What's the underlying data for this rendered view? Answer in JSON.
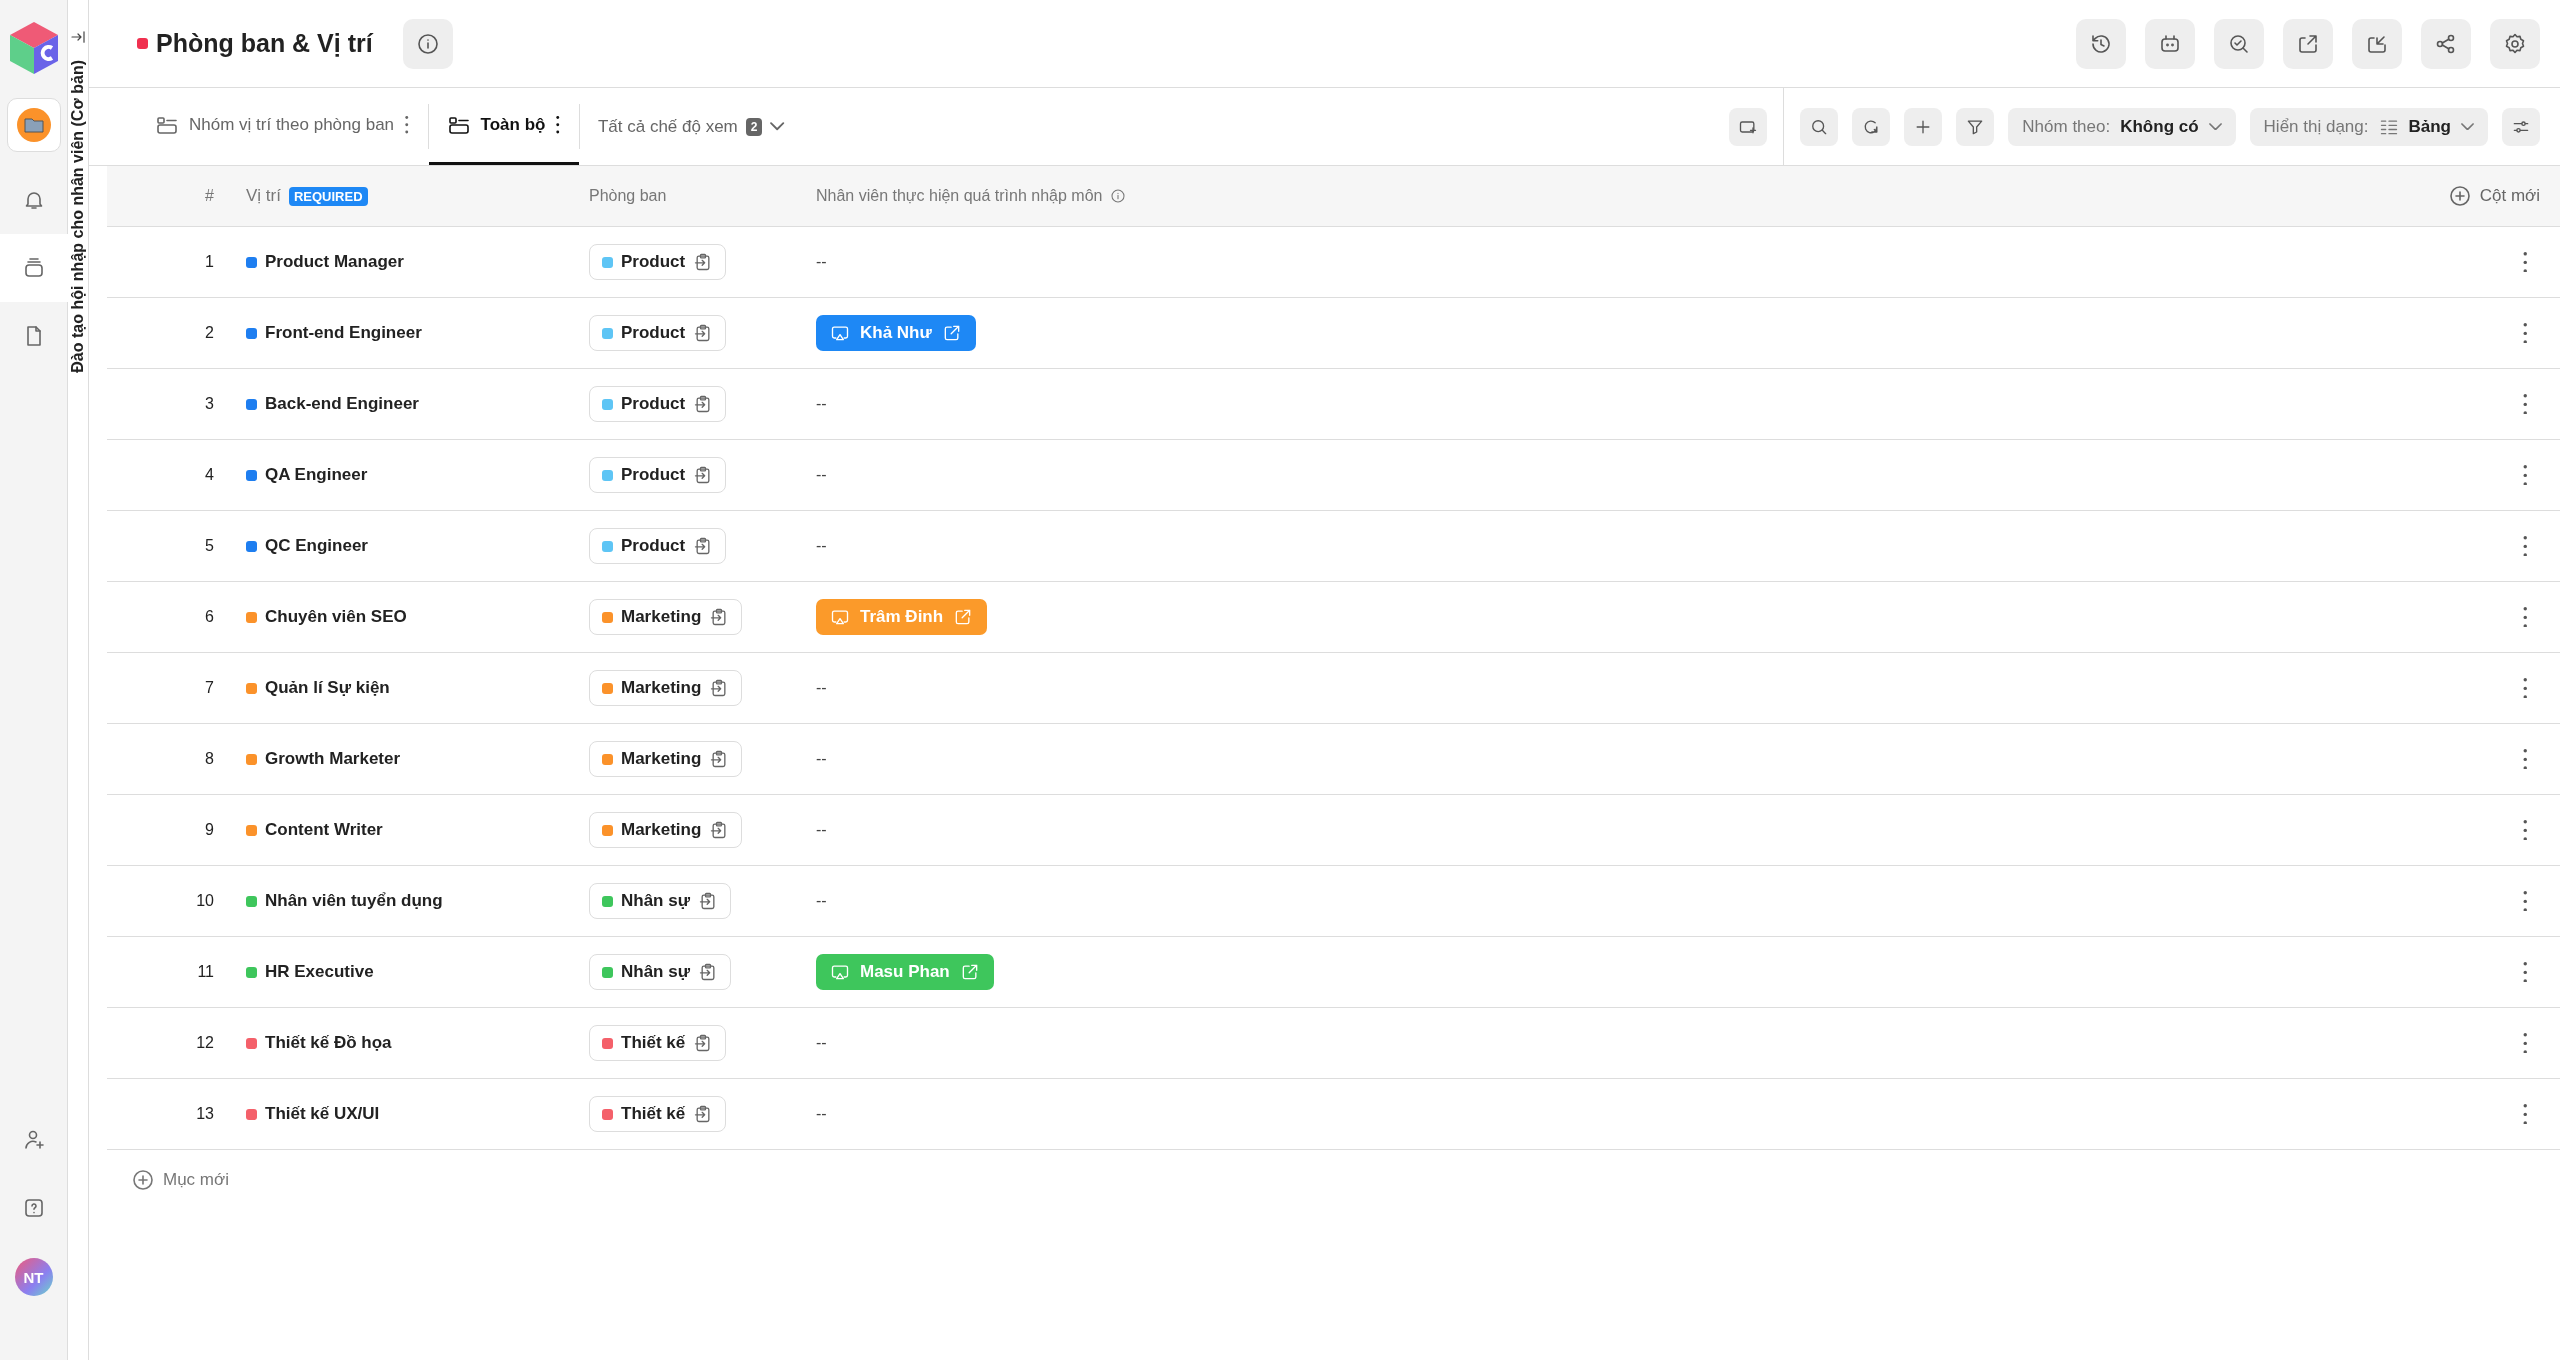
{
  "sidebar": {
    "items": [
      {
        "kind": "app",
        "selected": false
      },
      {
        "kind": "bell",
        "selected": false
      },
      {
        "kind": "stack",
        "selected": true
      },
      {
        "kind": "doc",
        "selected": false
      }
    ],
    "bottom": [
      {
        "kind": "user-add"
      },
      {
        "kind": "help"
      }
    ],
    "avatar": "NT"
  },
  "workspace_title": "Đào tạo hội nhập cho nhân viên (Cơ bản)",
  "header": {
    "title": "Phòng ban & Vị trí",
    "color": "#f0304f"
  },
  "views": [
    {
      "label": "Nhóm vị trí theo phòng ban",
      "selected": false
    },
    {
      "label": "Toàn bộ",
      "selected": true
    }
  ],
  "view_menu": {
    "label": "Tất cả chế độ xem",
    "count": "2"
  },
  "group_by": {
    "label": "Nhóm theo:",
    "value": "Không có"
  },
  "display": {
    "label": "Hiển thị dạng:",
    "value": "Bảng"
  },
  "table": {
    "columns": {
      "number": "#",
      "position": "Vị trí",
      "required": "REQUIRED",
      "department": "Phòng ban",
      "trainee": "Nhân viên thực hiện quá trình nhập môn",
      "add": "Cột mới"
    },
    "rows": [
      {
        "number": "1",
        "position": "Product Manager",
        "color": "#1e7ef0",
        "department": {
          "name": "Product",
          "color": "#5ec5f5"
        },
        "trainee": {
          "kind": "empty",
          "text": "--"
        }
      },
      {
        "number": "2",
        "position": "Front-end Engineer",
        "color": "#1e7ef0",
        "department": {
          "name": "Product",
          "color": "#5ec5f5"
        },
        "trainee": {
          "kind": "chip",
          "text": "Khả Như",
          "color": "#1e88f5"
        }
      },
      {
        "number": "3",
        "position": "Back-end Engineer",
        "color": "#1e7ef0",
        "department": {
          "name": "Product",
          "color": "#5ec5f5"
        },
        "trainee": {
          "kind": "empty",
          "text": "--"
        }
      },
      {
        "number": "4",
        "position": "QA Engineer",
        "color": "#1e7ef0",
        "department": {
          "name": "Product",
          "color": "#5ec5f5"
        },
        "trainee": {
          "kind": "empty",
          "text": "--"
        }
      },
      {
        "number": "5",
        "position": "QC Engineer",
        "color": "#1e7ef0",
        "department": {
          "name": "Product",
          "color": "#5ec5f5"
        },
        "trainee": {
          "kind": "empty",
          "text": "--"
        }
      },
      {
        "number": "6",
        "position": "Chuyên viên SEO",
        "color": "#fb922a",
        "department": {
          "name": "Marketing",
          "color": "#fb922a"
        },
        "trainee": {
          "kind": "chip",
          "text": "Trâm Đinh",
          "color": "#fb9a2a"
        }
      },
      {
        "number": "7",
        "position": "Quản lí Sự kiện",
        "color": "#fb922a",
        "department": {
          "name": "Marketing",
          "color": "#fb922a"
        },
        "trainee": {
          "kind": "empty",
          "text": "--"
        }
      },
      {
        "number": "8",
        "position": "Growth Marketer",
        "color": "#fb922a",
        "department": {
          "name": "Marketing",
          "color": "#fb922a"
        },
        "trainee": {
          "kind": "empty",
          "text": "--"
        }
      },
      {
        "number": "9",
        "position": "Content Writer",
        "color": "#fb922a",
        "department": {
          "name": "Marketing",
          "color": "#fb922a"
        },
        "trainee": {
          "kind": "empty",
          "text": "--"
        }
      },
      {
        "number": "10",
        "position": "Nhân viên tuyển dụng",
        "color": "#3ec65c",
        "department": {
          "name": "Nhân sự",
          "color": "#3ec65c"
        },
        "trainee": {
          "kind": "empty",
          "text": "--"
        }
      },
      {
        "number": "11",
        "position": "HR Executive",
        "color": "#3ec65c",
        "department": {
          "name": "Nhân sự",
          "color": "#3ec65c"
        },
        "trainee": {
          "kind": "chip",
          "text": "Masu Phan",
          "color": "#3ec65c"
        }
      },
      {
        "number": "12",
        "position": "Thiết kế Đồ họa",
        "color": "#f4606a",
        "department": {
          "name": "Thiết kế",
          "color": "#f4606a"
        },
        "trainee": {
          "kind": "empty",
          "text": "--"
        }
      },
      {
        "number": "13",
        "position": "Thiết kế UX/UI",
        "color": "#f4606a",
        "department": {
          "name": "Thiết kế",
          "color": "#f4606a"
        },
        "trainee": {
          "kind": "empty",
          "text": "--"
        }
      }
    ],
    "add_row": "Mục mới"
  }
}
